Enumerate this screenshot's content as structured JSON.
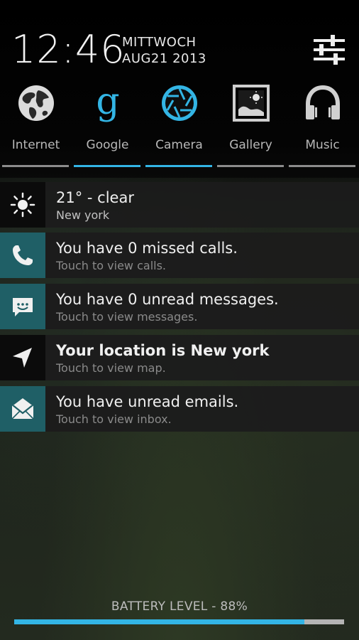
{
  "header": {
    "time": "12:46",
    "weekday": "MITTWOCH",
    "date": "AUG21 2013",
    "settings_icon": "settings-sliders-icon"
  },
  "apps": [
    {
      "label": "Internet",
      "icon": "globe-icon",
      "active": false
    },
    {
      "label": "Google",
      "icon": "google-icon",
      "active": true
    },
    {
      "label": "Camera",
      "icon": "camera-aperture-icon",
      "active": true
    },
    {
      "label": "Gallery",
      "icon": "gallery-icon",
      "active": false
    },
    {
      "label": "Music",
      "icon": "headphones-icon",
      "active": false
    }
  ],
  "notifications": {
    "weather": {
      "title": "21° -   clear",
      "subtitle": "New york",
      "icon": "sun-icon"
    },
    "calls": {
      "title": "You have 0 missed calls.",
      "subtitle": "Touch to view calls.",
      "icon": "phone-icon"
    },
    "messages": {
      "title": "You have 0 unread messages.",
      "subtitle": "Touch to view messages.",
      "icon": "message-icon"
    },
    "location": {
      "title": "Your location is New york",
      "subtitle": "Touch to view map.",
      "icon": "location-arrow-icon"
    },
    "email": {
      "title": "You have unread emails.",
      "subtitle": "Touch to view inbox.",
      "icon": "envelope-icon"
    }
  },
  "battery": {
    "label": "BATTERY LEVEL - 88%",
    "level_percent": 88
  },
  "colors": {
    "accent": "#33b5e5",
    "icon_box": "#1f5f66"
  }
}
